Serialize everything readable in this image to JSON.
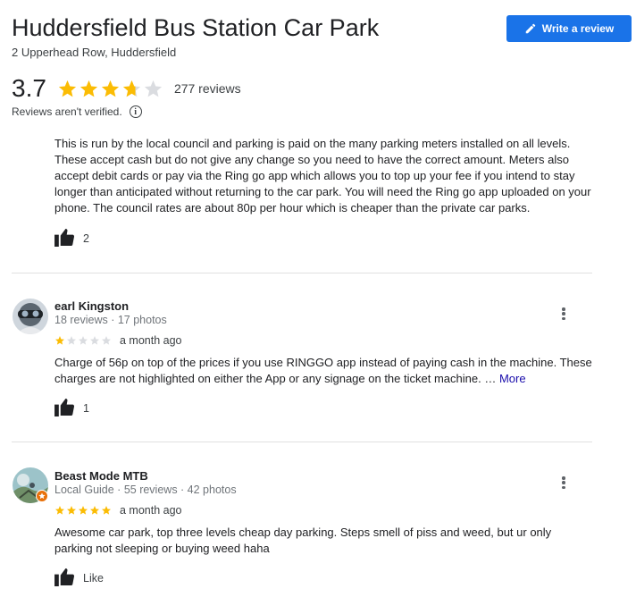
{
  "place": {
    "title": "Huddersfield Bus Station Car Park",
    "address": "2 Upperhead Row, Huddersfield",
    "write_review_label": "Write a review"
  },
  "summary": {
    "rating": "3.7",
    "rating_value": 3.7,
    "review_count": "277 reviews",
    "unverified_note": "Reviews aren't verified.",
    "info_icon": "i"
  },
  "reviews": [
    {
      "text": "This is run by the local council and parking is paid on the many parking meters installed on all levels. These accept cash but do not give any change so you need to have the correct amount. Meters also accept debit cards or pay via the Ring go app which allows you to top up your fee if you intend to stay longer than anticipated without returning to the car park. You will need the Ring go app uploaded on your phone. The council rates are about 80p per hour which is cheaper than the private car parks.",
      "likes": "2"
    },
    {
      "name": "earl Kingston",
      "meta": "18 reviews · 17 photos",
      "rating_value": 1,
      "time": "a month ago",
      "text": "Charge of 56p on top of the prices if you use RINGGO app instead of paying cash in the machine. These charges are not highlighted on either the App or any signage on the ticket machine. …",
      "more_label": "More",
      "likes": "1"
    },
    {
      "name": "Beast Mode MTB",
      "meta": "Local Guide · 55 reviews · 42 photos",
      "rating_value": 5,
      "time": "a month ago",
      "text": "Awesome car park, top three levels cheap day parking. Steps smell of piss and weed, but ur only parking not sleeping or buying weed haha",
      "likes": "Like"
    }
  ],
  "colors": {
    "star_filled": "#fbbc04",
    "star_empty": "#dadce0",
    "accent": "#1a73e8",
    "local_guide_badge": "#e8710a"
  },
  "icons": [
    "pencil-icon",
    "star-icon",
    "info-icon",
    "thumbs-up-icon",
    "more-vert-icon",
    "local-guide-badge-icon"
  ]
}
